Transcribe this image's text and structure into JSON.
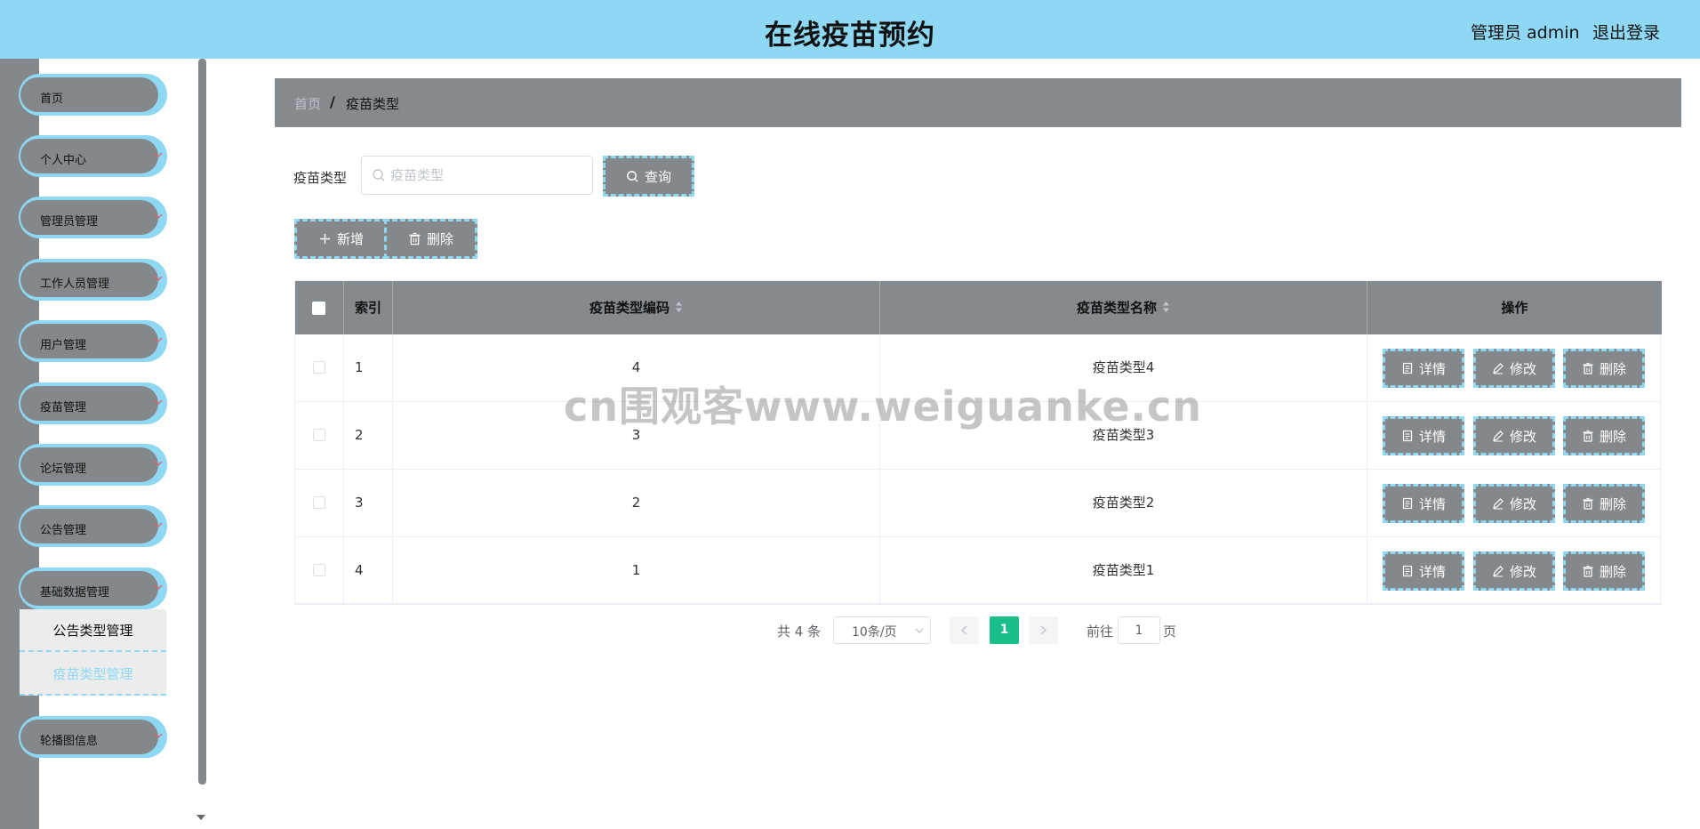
{
  "header": {
    "title": "在线疫苗预约",
    "user_label": "管理员 admin",
    "logout_label": "退出登录",
    "color": "#8ed8f4"
  },
  "sidebar": {
    "items": [
      {
        "label": "首页",
        "has_arrow": false
      },
      {
        "label": "个人中心",
        "has_arrow": true
      },
      {
        "label": "管理员管理",
        "has_arrow": true
      },
      {
        "label": "工作人员管理",
        "has_arrow": true
      },
      {
        "label": "用户管理",
        "has_arrow": true
      },
      {
        "label": "疫苗管理",
        "has_arrow": true
      },
      {
        "label": "论坛管理",
        "has_arrow": true
      },
      {
        "label": "公告管理",
        "has_arrow": true
      },
      {
        "label": "基础数据管理",
        "has_arrow": true,
        "expanded": true
      },
      {
        "label": "轮播图信息",
        "has_arrow": true
      }
    ],
    "submenu": [
      {
        "label": "公告类型管理"
      },
      {
        "label": "疫苗类型管理",
        "active": true
      }
    ],
    "accent_color": "#8ed8f4",
    "item_color": "#84888b",
    "arrow_color": "#e06070"
  },
  "breadcrumb": {
    "home": "首页",
    "separator": "/",
    "current": "疫苗类型"
  },
  "search": {
    "label": "疫苗类型",
    "placeholder": "疫苗类型",
    "value": "",
    "button_label": "查询"
  },
  "actions": {
    "add_label": "新增",
    "delete_label": "删除"
  },
  "table": {
    "columns": [
      "索引",
      "疫苗类型编码",
      "疫苗类型名称",
      "操作"
    ],
    "rows": [
      {
        "index": "1",
        "code": "4",
        "name": "疫苗类型4"
      },
      {
        "index": "2",
        "code": "3",
        "name": "疫苗类型3"
      },
      {
        "index": "3",
        "code": "2",
        "name": "疫苗类型2"
      },
      {
        "index": "4",
        "code": "1",
        "name": "疫苗类型1"
      }
    ],
    "row_actions": [
      "详情",
      "修改",
      "删除"
    ],
    "header_color": "#848a8e"
  },
  "pagination": {
    "total_text": "共 4 条",
    "page_size": "10条/页",
    "current_page": "1",
    "goto_label": "前往",
    "goto_value": "1",
    "page_suffix": "页",
    "active_color": "#19be8b"
  },
  "watermark": "cn围观客www.weiguanke.cn"
}
